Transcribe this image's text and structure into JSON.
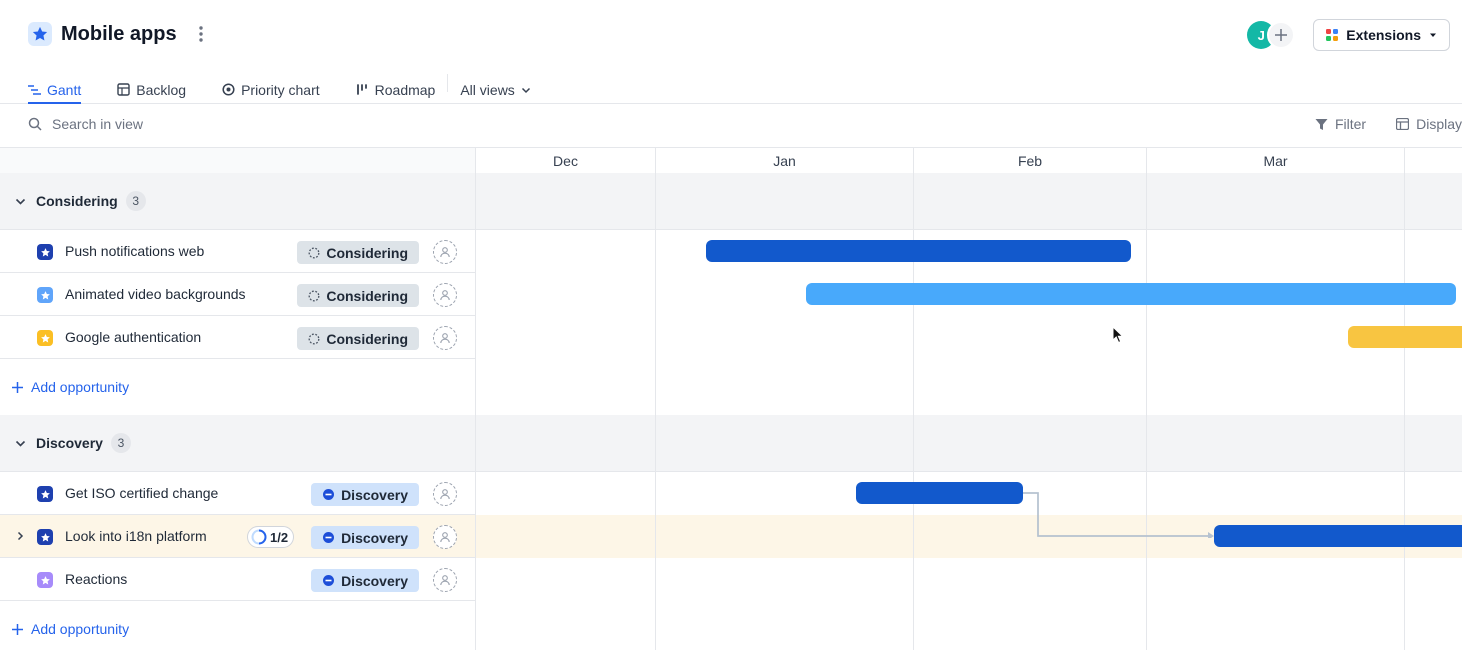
{
  "header": {
    "title": "Mobile apps",
    "avatar_initial": "J",
    "extensions_label": "Extensions",
    "accent": "#2563eb"
  },
  "tabs": [
    {
      "label": "Gantt",
      "icon": "gantt-icon",
      "active": true
    },
    {
      "label": "Backlog",
      "icon": "backlog-icon",
      "active": false
    },
    {
      "label": "Priority chart",
      "icon": "priority-chart-icon",
      "active": false
    },
    {
      "label": "Roadmap",
      "icon": "roadmap-icon",
      "active": false
    },
    {
      "label": "All views",
      "icon": "chevron-down-icon",
      "active": false
    }
  ],
  "toolbar": {
    "search_placeholder": "Search in view",
    "filter_label": "Filter",
    "display_label": "Display"
  },
  "timeline": {
    "months": [
      "Dec",
      "Jan",
      "Feb",
      "Mar"
    ]
  },
  "groups": [
    {
      "name": "Considering",
      "count": "3",
      "add_label": "Add opportunity",
      "items": [
        {
          "name": "Push notifications web",
          "status": "Considering",
          "icon_color": "#1e40af",
          "bar_color": "#1259cc"
        },
        {
          "name": "Animated video backgrounds",
          "status": "Considering",
          "icon_color": "#60a5fa",
          "bar_color": "#48a9fb"
        },
        {
          "name": "Google authentication",
          "status": "Considering",
          "icon_color": "#fbbf24",
          "bar_color": "#f8c541"
        }
      ]
    },
    {
      "name": "Discovery",
      "count": "3",
      "add_label": "Add opportunity",
      "items": [
        {
          "name": "Get ISO certified change",
          "status": "Discovery",
          "icon_color": "#1e40af",
          "bar_color": "#1259cc"
        },
        {
          "name": "Look into i18n platform",
          "status": "Discovery",
          "icon_color": "#1e40af",
          "bar_color": "#1259cc",
          "progress": "1/2",
          "highlight": "#fdf6e7"
        },
        {
          "name": "Reactions",
          "status": "Discovery",
          "icon_color": "#a78bfa"
        }
      ]
    }
  ]
}
